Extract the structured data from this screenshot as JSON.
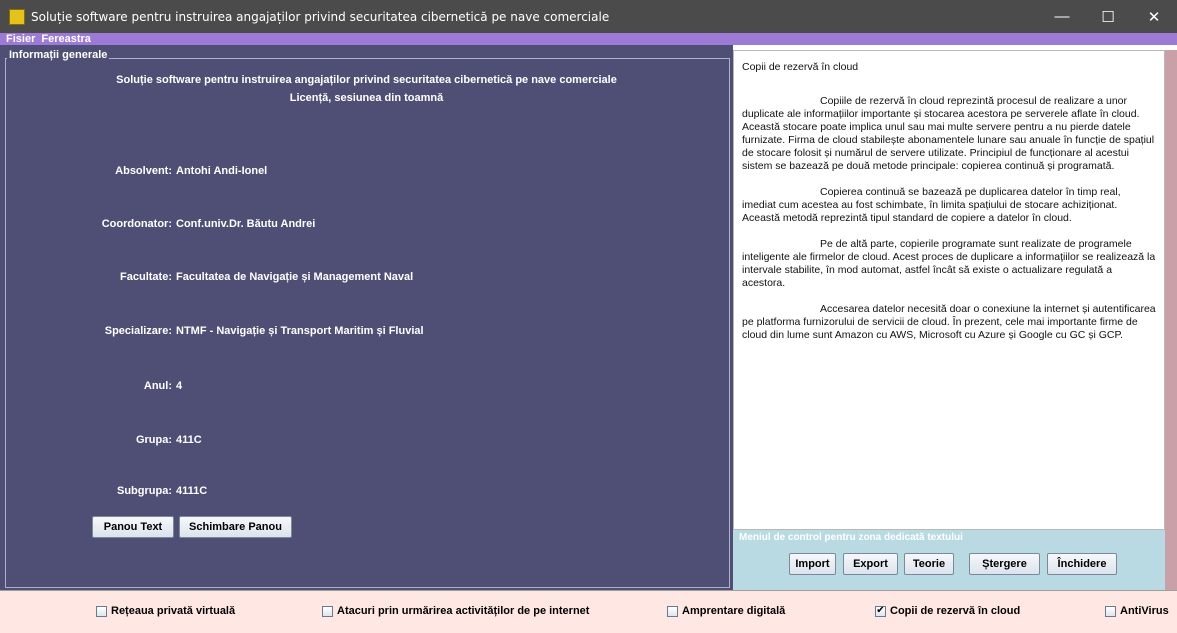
{
  "window": {
    "title": "Soluție software pentru instruirea angajaților privind securitatea cibernetică pe nave comerciale",
    "minimize_glyph": "—",
    "maximize_glyph": "☐",
    "close_glyph": "✕"
  },
  "menu": [
    "Fisier",
    "Fereastra"
  ],
  "left": {
    "group_title": "Informații generale",
    "heading": "Soluție software pentru instruirea angajaților privind securitatea cibernetică pe nave comerciale",
    "subheading": "Licență, sesiunea din toamnă",
    "rows": [
      {
        "label": "Absolvent:",
        "value": "Antohi Andi-Ionel"
      },
      {
        "label": "Coordonator:",
        "value": "Conf.univ.Dr. Băutu Andrei"
      },
      {
        "label": "Facultate:",
        "value": "Facultatea de Navigație și Management Naval"
      },
      {
        "label": "Specializare:",
        "value": "NTMF - Navigație și Transport Maritim și Fluvial"
      },
      {
        "label": "Anul:",
        "value": "4"
      },
      {
        "label": "Grupa:",
        "value": "411C"
      },
      {
        "label": "Subgrupa:",
        "value": "4111C"
      }
    ],
    "buttons": {
      "panou_text": "Panou Text",
      "schimbare_panou": "Schimbare Panou"
    }
  },
  "right": {
    "text_title": "Copii de rezervă în cloud",
    "paragraphs": [
      "Copiile de rezervă în cloud reprezintă procesul de realizare a unor duplicate ale informațiilor importante și stocarea acestora pe serverele aflate în cloud. Această stocare poate implica unul sau mai multe servere pentru a nu pierde datele furnizate. Firma de cloud stabilește abonamentele lunare sau anuale în funcție de spațiul de stocare folosit și numărul de servere utilizate. Principiul de funcționare al acestui sistem se bazează pe două metode principale: copierea continuă și programată.",
      "Copierea continuă se bazează pe duplicarea datelor în timp real, imediat cum acestea au fost schimbate, în limita spațiului de stocare achiziționat. Această metodă reprezintă tipul standard de copiere a datelor în cloud.",
      "Pe de altă parte, copierile programate sunt realizate de programele inteligente ale firmelor de cloud. Acest proces de duplicare a informațiilor se realizează la intervale stabilite, în mod automat, astfel încât să existe o actualizare regulată a acestora.",
      "Accesarea datelor necesită doar o conexiune la internet și autentificarea pe platforma furnizorului de servicii de cloud. În prezent, cele mai importante firme de cloud din lume sunt Amazon cu AWS, Microsoft cu Azure și Google cu GC și GCP."
    ],
    "control_title": "Meniul de control pentru zona dedicată textului",
    "control_buttons": [
      "Import",
      "Export",
      "Teorie",
      "Ștergere",
      "Închidere"
    ]
  },
  "bottom": {
    "options": [
      {
        "label": "Rețeaua privată virtuală",
        "checked": false
      },
      {
        "label": "Atacuri prin urmărirea activităților de pe internet",
        "checked": false
      },
      {
        "label": "Amprentare digitală",
        "checked": false
      },
      {
        "label": "Copii de rezervă în cloud",
        "checked": true
      },
      {
        "label": "AntiVirus",
        "checked": false
      }
    ],
    "check_glyph": "✔"
  },
  "colors": {
    "title_bar": "#4b4b4b",
    "menu_bar": "#9c7ad6",
    "left_panel": "#4f4f75",
    "control_zone": "#b9d9e3",
    "bottom_bar": "#ffe8e4",
    "scroll_strip": "#c9a0a8"
  }
}
